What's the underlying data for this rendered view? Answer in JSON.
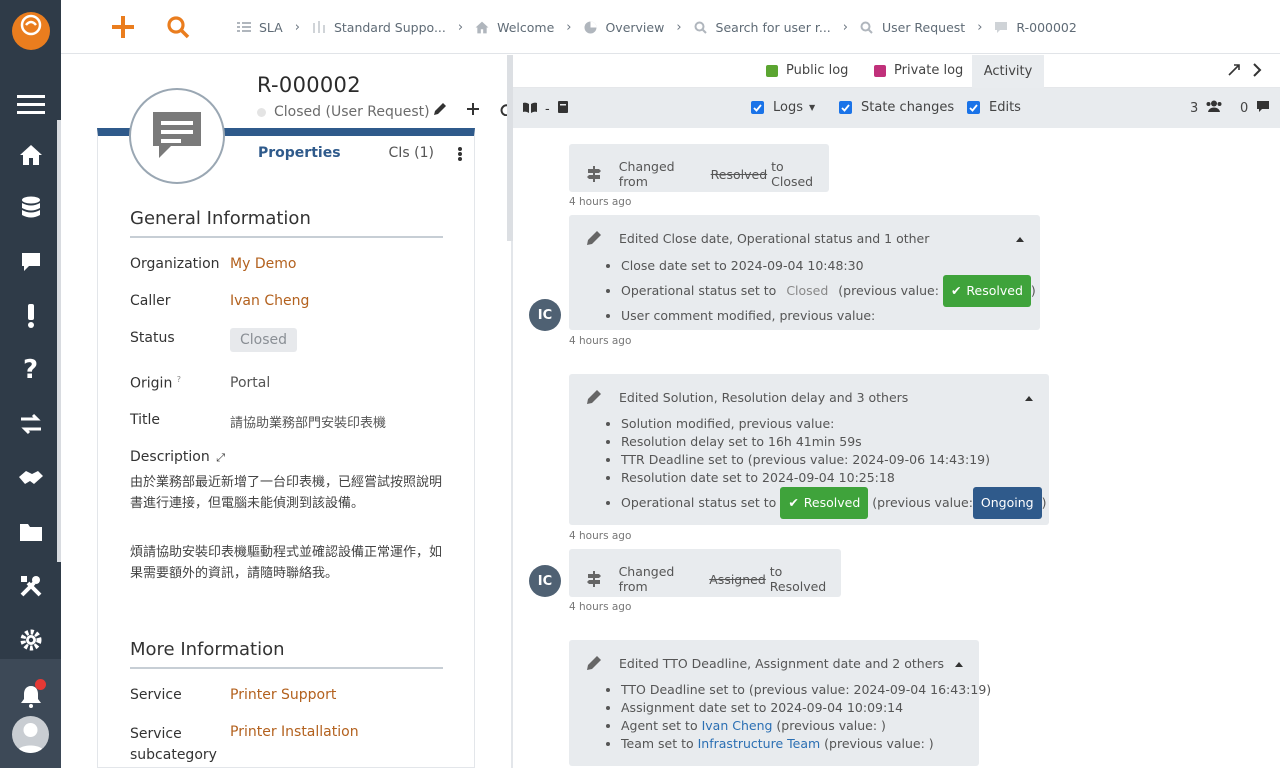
{
  "topbar": {
    "breadcrumbs": [
      {
        "label": "SLA",
        "icon": "list-icon"
      },
      {
        "label": "Standard Suppo...",
        "icon": "bars-icon"
      },
      {
        "label": "Welcome",
        "icon": "home-icon"
      },
      {
        "label": "Overview",
        "icon": "pie-icon"
      },
      {
        "label": "Search for user r...",
        "icon": "search-icon"
      },
      {
        "label": "User Request",
        "icon": "search-icon"
      },
      {
        "label": "R-000002",
        "icon": "message-icon"
      }
    ]
  },
  "object": {
    "ref": "R-000002",
    "status": "Closed",
    "class_label": "(User Request)"
  },
  "tabs": {
    "properties": "Properties",
    "cis": "CIs (1)"
  },
  "general": {
    "title": "General Information",
    "organization_label": "Organization",
    "organization_value": "My Demo",
    "caller_label": "Caller",
    "caller_value": "Ivan Cheng",
    "status_label": "Status",
    "status_value": "Closed",
    "origin_label": "Origin",
    "origin_hint": "?",
    "origin_value": "Portal",
    "title_label": "Title",
    "title_value": "請協助業務部門安裝印表機",
    "description_label": "Description",
    "description_p1": "由於業務部最近新增了一台印表機，已經嘗試按照說明書進行連接，但電腦未能偵測到該設備。",
    "description_p2": "煩請協助安裝印表機驅動程式並確認設備正常運作，如果需要額外的資訊，請隨時聯絡我。"
  },
  "more": {
    "title": "More Information",
    "service_label": "Service",
    "service_value": "Printer Support",
    "subcategory_label_1": "Service",
    "subcategory_label_2": "subcategory",
    "subcategory_value": "Printer Installation"
  },
  "activity": {
    "tab_public": "Public log",
    "tab_private": "Private log",
    "tab_activity": "Activity",
    "public_color": "#5ba531",
    "private_color": "#c0307a",
    "filter_logs": "Logs",
    "filter_state": "State changes",
    "filter_edits": "Edits",
    "toggle_dash": "-",
    "count_people": "3",
    "count_messages": "0",
    "entries": {
      "e1": {
        "prefix": "Changed from",
        "from": "Resolved",
        "to_text": "to Closed",
        "time": "4 hours ago"
      },
      "e2": {
        "head": "Edited Close date, Operational status and 1 other",
        "l1": "Close date set to 2024-09-04 10:48:30",
        "l2_a": "Operational status set to",
        "l2_b": "Closed",
        "l2_c": "(previous value:",
        "l2_d": "Resolved",
        "l2_e": ")",
        "l3": "User comment modified, previous value:",
        "time": "4 hours ago",
        "author": "IC"
      },
      "e3": {
        "head": "Edited Solution, Resolution delay and 3 others",
        "l1": "Solution modified, previous value:",
        "l2": "Resolution delay set to 16h 41min 59s",
        "l3": "TTR Deadline set to (previous value: 2024-09-06 14:43:19)",
        "l4": "Resolution date set to 2024-09-04 10:25:18",
        "l5_a": "Operational status set to",
        "l5_b": "Resolved",
        "l5_c": "(previous value:",
        "l5_d": "Ongoing",
        "l5_e": ")",
        "time": "4 hours ago"
      },
      "e4": {
        "prefix": "Changed from",
        "from": "Assigned",
        "to_text": "to Resolved",
        "time": "4 hours ago",
        "author": "IC"
      },
      "e5": {
        "head": "Edited TTO Deadline, Assignment date and 2 others",
        "l1": "TTO Deadline set to (previous value: 2024-09-04 16:43:19)",
        "l2": "Assignment date set to 2024-09-04 10:09:14",
        "l3_a": "Agent set to",
        "l3_b": "Ivan Cheng",
        "l3_c": "(previous value: )",
        "l4_a": "Team set to",
        "l4_b": "Infrastructure Team",
        "l4_c": "(previous value: )"
      }
    }
  }
}
